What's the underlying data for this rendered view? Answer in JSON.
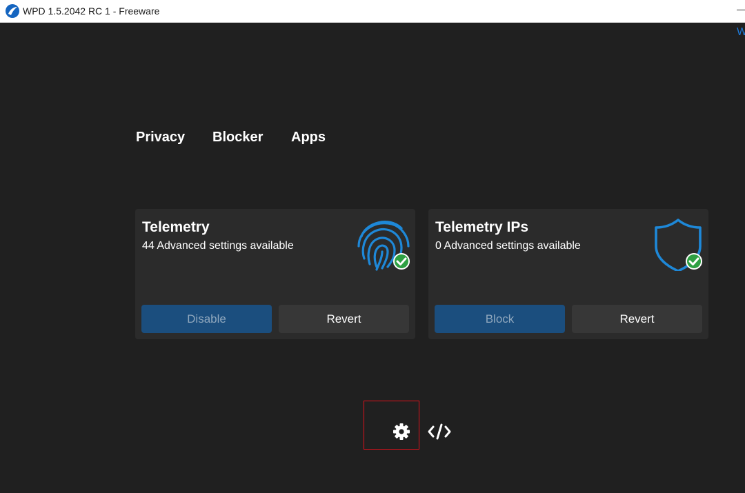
{
  "window": {
    "title": "WPD 1.5.2042 RC 1 - Freeware",
    "edge_text": "W"
  },
  "nav": {
    "items": [
      {
        "label": "Privacy"
      },
      {
        "label": "Blocker"
      },
      {
        "label": "Apps"
      }
    ]
  },
  "cards": [
    {
      "title": "Telemetry",
      "subtitle": "44 Advanced settings available",
      "icon": "fingerprint-icon",
      "status": "check",
      "primary_label": "Disable",
      "secondary_label": "Revert"
    },
    {
      "title": "Telemetry IPs",
      "subtitle": "0 Advanced settings available",
      "icon": "shield-icon",
      "status": "check",
      "primary_label": "Block",
      "secondary_label": "Revert"
    }
  ],
  "footer": {
    "icons": [
      "gear-icon",
      "code-icon"
    ]
  },
  "colors": {
    "background": "#202020",
    "card": "#2b2b2b",
    "accent": "#1b4e7e",
    "icon_blue": "#1e88d8",
    "check_green": "#2ea043",
    "highlight_red": "#e0111b"
  }
}
